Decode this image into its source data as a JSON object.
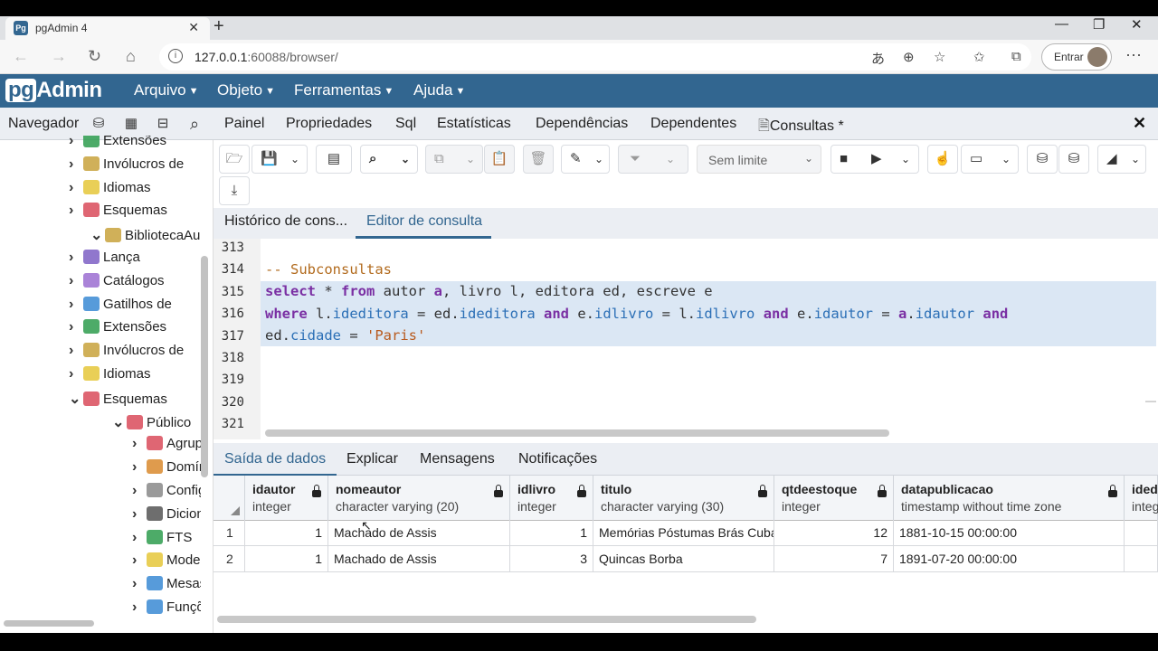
{
  "browser": {
    "tab_title": "pgAdmin 4",
    "favicon": "Pg",
    "url_host": "127.0.0.1",
    "url_path": ":60088/browser/",
    "profile_label": "Entrar"
  },
  "app": {
    "logo_pg": "pg",
    "logo_rest": "Admin",
    "menu": [
      "Arquivo",
      "Objeto",
      "Ferramentas",
      "Ajuda"
    ]
  },
  "navigator": {
    "label": "Navegador",
    "tree": [
      {
        "label": "Extensões",
        "indent": 1,
        "arrow": ">",
        "icon": "extensions-icon",
        "color": "#2e9c4e"
      },
      {
        "label": "Invólucros de",
        "indent": 1,
        "arrow": ">",
        "icon": "wrappers-icon",
        "color": "#c8a23c"
      },
      {
        "label": "Idiomas",
        "indent": 1,
        "arrow": ">",
        "icon": "languages-icon",
        "color": "#e5c73a"
      },
      {
        "label": "Esquemas",
        "indent": 1,
        "arrow": ">",
        "icon": "schemas-icon",
        "color": "#d94b5b"
      },
      {
        "label": "BibliotecaAula",
        "indent": 0,
        "arrow": "v",
        "icon": "database-icon",
        "color": "#c8a23c"
      },
      {
        "label": "Lança",
        "indent": 1,
        "arrow": ">",
        "icon": "cast-icon",
        "color": "#7d5fc4"
      },
      {
        "label": "Catálogos",
        "indent": 1,
        "arrow": ">",
        "icon": "catalogs-icon",
        "color": "#9b6dd1"
      },
      {
        "label": "Gatilhos de",
        "indent": 1,
        "arrow": ">",
        "icon": "event-triggers-icon",
        "color": "#3a8ad4"
      },
      {
        "label": "Extensões",
        "indent": 1,
        "arrow": ">",
        "icon": "extensions-icon",
        "color": "#2e9c4e"
      },
      {
        "label": "Invólucros de",
        "indent": 1,
        "arrow": ">",
        "icon": "wrappers-icon",
        "color": "#c8a23c"
      },
      {
        "label": "Idiomas",
        "indent": 1,
        "arrow": ">",
        "icon": "languages-icon",
        "color": "#e5c73a"
      },
      {
        "label": "Esquemas",
        "indent": 1,
        "arrow": "v",
        "icon": "schemas-icon",
        "color": "#d94b5b"
      },
      {
        "label": "Público",
        "indent": 2,
        "arrow": "v",
        "icon": "schema-public-icon",
        "color": "#d94b5b"
      },
      {
        "label": "Agrupamentos",
        "indent": 3,
        "arrow": ">",
        "icon": "collations-icon",
        "color": "#d94b5b"
      },
      {
        "label": "Domínios",
        "indent": 3,
        "arrow": ">",
        "icon": "domains-icon",
        "color": "#d98a2e"
      },
      {
        "label": "Configurações",
        "indent": 3,
        "arrow": ">",
        "icon": "fts-config-icon",
        "color": "#888888"
      },
      {
        "label": "Dicionários",
        "indent": 3,
        "arrow": ">",
        "icon": "fts-dict-icon",
        "color": "#555555"
      },
      {
        "label": "FTS",
        "indent": 3,
        "arrow": ">",
        "icon": "fts-parser-icon",
        "color": "#2e9c4e"
      },
      {
        "label": "Modelos",
        "indent": 3,
        "arrow": ">",
        "icon": "fts-templates-icon",
        "color": "#e5c73a"
      },
      {
        "label": "Mesas",
        "indent": 3,
        "arrow": ">",
        "icon": "foreign-tables-icon",
        "color": "#3a8ad4"
      },
      {
        "label": "Funções",
        "indent": 3,
        "arrow": ">",
        "icon": "functions-icon",
        "color": "#3a8ad4"
      }
    ]
  },
  "main_tabs": [
    "Painel",
    "Propriedades",
    "Sql",
    "Estatísticas",
    "Dependências",
    "Dependentes",
    "Consultas *"
  ],
  "toolbar": {
    "limit_label": "Sem limite"
  },
  "sub_tabs": [
    "Histórico de cons...",
    "Editor de consulta"
  ],
  "editor": {
    "line_numbers": [
      "313",
      "314",
      "315",
      "316",
      "317",
      "318",
      "319",
      "320",
      "321"
    ],
    "lines": {
      "l314": "-- Subconsultas",
      "l315": [
        {
          "t": "select",
          "c": "kw"
        },
        {
          "t": " * ",
          "c": ""
        },
        {
          "t": "from",
          "c": "kw"
        },
        {
          "t": " autor ",
          "c": ""
        },
        {
          "t": "a",
          "c": "kw"
        },
        {
          "t": ", livro l, editora ed, escreve e",
          "c": ""
        }
      ],
      "l316": [
        {
          "t": "where",
          "c": "kw"
        },
        {
          "t": " l.",
          "c": ""
        },
        {
          "t": "ideditora",
          "c": "fld"
        },
        {
          "t": " = ed.",
          "c": ""
        },
        {
          "t": "ideditora",
          "c": "fld"
        },
        {
          "t": " ",
          "c": ""
        },
        {
          "t": "and",
          "c": "kw"
        },
        {
          "t": " e.",
          "c": ""
        },
        {
          "t": "idlivro",
          "c": "fld"
        },
        {
          "t": " = l.",
          "c": ""
        },
        {
          "t": "idlivro",
          "c": "fld"
        },
        {
          "t": " ",
          "c": ""
        },
        {
          "t": "and",
          "c": "kw"
        },
        {
          "t": " e.",
          "c": ""
        },
        {
          "t": "idautor",
          "c": "fld"
        },
        {
          "t": " = ",
          "c": ""
        },
        {
          "t": "a",
          "c": "kw"
        },
        {
          "t": ".",
          "c": ""
        },
        {
          "t": "idautor",
          "c": "fld"
        },
        {
          "t": " ",
          "c": ""
        },
        {
          "t": "and",
          "c": "kw"
        }
      ],
      "l317": [
        {
          "t": "ed.",
          "c": ""
        },
        {
          "t": "cidade",
          "c": "fld"
        },
        {
          "t": " = ",
          "c": ""
        },
        {
          "t": "'Paris'",
          "c": "st"
        }
      ]
    }
  },
  "output_tabs": [
    "Saída de dados",
    "Explicar",
    "Mensagens",
    "Notificações"
  ],
  "grid": {
    "columns": [
      {
        "name": "idautor",
        "type": "integer"
      },
      {
        "name": "nomeautor",
        "type": "character varying (20)"
      },
      {
        "name": "idlivro",
        "type": "integer"
      },
      {
        "name": "titulo",
        "type": "character varying (30)"
      },
      {
        "name": "qtdeestoque",
        "type": "integer"
      },
      {
        "name": "datapublicacao",
        "type": "timestamp without time zone"
      },
      {
        "name": "ideditora",
        "type": "integer"
      }
    ],
    "rows": [
      {
        "rn": "1",
        "cells": [
          "1",
          "Machado de Assis",
          "1",
          "Memórias Póstumas Brás Cubas",
          "12",
          "1881-10-15 00:00:00",
          ""
        ]
      },
      {
        "rn": "2",
        "cells": [
          "1",
          "Machado de Assis",
          "3",
          "Quincas Borba",
          "7",
          "1891-07-20 00:00:00",
          ""
        ]
      }
    ]
  },
  "colors": {
    "pgadmin_blue": "#326690",
    "selection": "#dbe7f4",
    "keyword": "#7a2fa3"
  }
}
